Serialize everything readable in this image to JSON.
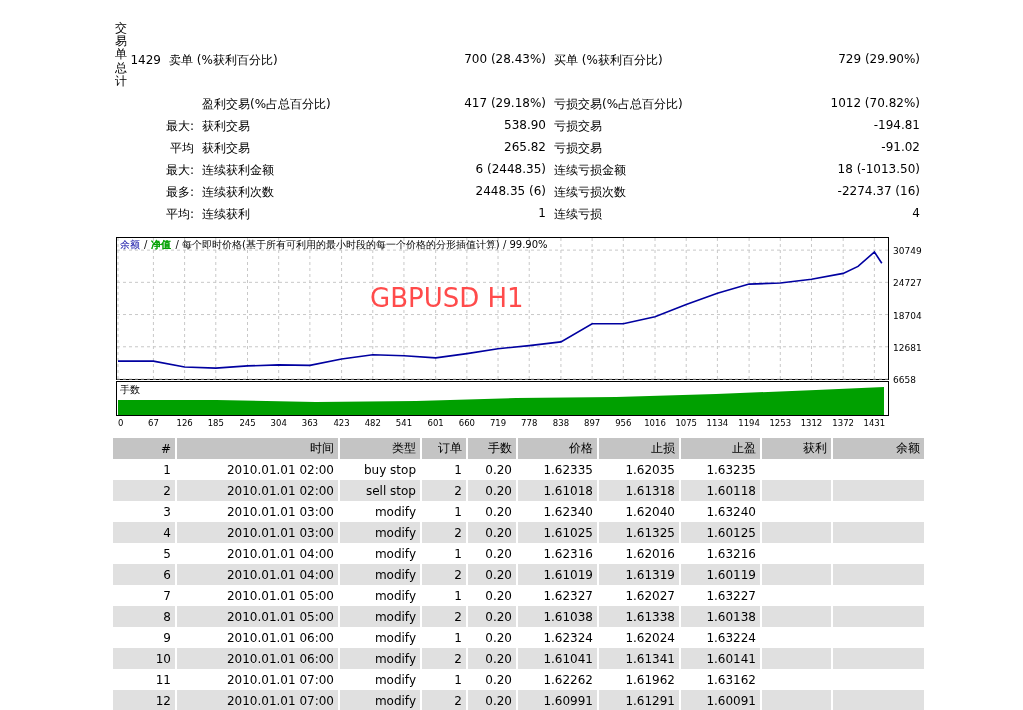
{
  "stats": {
    "side_label": "交易单总计",
    "rows": [
      {
        "count": "1429",
        "label": "卖单 (%获利百分比)",
        "value": "700 (28.43%)",
        "label2": "买单 (%获利百分比)",
        "value2": "729 (29.90%)"
      },
      {
        "label": "盈利交易(%占总百分比)",
        "value": "417 (29.18%)",
        "label2": "亏损交易(%占总百分比)",
        "value2": "1012 (70.82%)"
      },
      {
        "prefix": "最大:",
        "label": "获利交易",
        "value": "538.90",
        "label2": "亏损交易",
        "value2": "-194.81"
      },
      {
        "prefix": "平均",
        "label": "获利交易",
        "value": "265.82",
        "label2": "亏损交易",
        "value2": "-91.02"
      },
      {
        "prefix": "最大:",
        "label": "连续获利金额",
        "value": "6 (2448.35)",
        "label2": "连续亏损金额",
        "value2": "18 (-1013.50)"
      },
      {
        "prefix": "最多:",
        "label": "连续获利次数",
        "value": "2448.35 (6)",
        "label2": "连续亏损次数",
        "value2": "-2274.37 (16)"
      },
      {
        "prefix": "平均:",
        "label": "连续获利",
        "value": "1",
        "label2": "连续亏损",
        "value2": "4"
      }
    ]
  },
  "chart": {
    "legend": [
      {
        "text": "/"
      },
      {
        "text": "净值",
        "color": "#00a000"
      },
      {
        "text": "/ 每个即时价格(基于所有可利用的最小时段的每一个价格的分形插值计算) / 99.90%"
      }
    ],
    "overlay_label": "GBPUSD H1",
    "volume_label": "手数",
    "chart_data": {
      "type": "line",
      "x": [
        0,
        67,
        126,
        185,
        245,
        304,
        363,
        423,
        482,
        541,
        601,
        660,
        719,
        778,
        838,
        897,
        956,
        1016,
        1075,
        1134,
        1194,
        1253,
        1312,
        1372,
        1400,
        1431,
        1445
      ],
      "series": [
        {
          "name": "余额",
          "color": "#0000a0",
          "values": [
            10000,
            10000,
            8900,
            8700,
            9100,
            9300,
            9200,
            10400,
            11200,
            11000,
            10600,
            11400,
            12300,
            12900,
            13600,
            17000,
            17000,
            18300,
            20600,
            22700,
            24400,
            24600,
            25300,
            26400,
            27700,
            30400,
            28300
          ]
        }
      ],
      "grid": true,
      "xlim": [
        0,
        1453
      ],
      "ylim": [
        6658,
        33200
      ],
      "xticks": [
        0,
        67,
        126,
        185,
        245,
        304,
        363,
        423,
        482,
        541,
        601,
        660,
        719,
        778,
        838,
        897,
        956,
        1016,
        1075,
        1134,
        1194,
        1253,
        1312,
        1372,
        1431
      ],
      "yticks": [
        6658,
        12681,
        18704,
        24727,
        30749
      ]
    }
  },
  "table": {
    "columns": [
      "#",
      "时间",
      "类型",
      "订单",
      "手数",
      "价格",
      "止损",
      "止盈",
      "获利",
      "余额"
    ],
    "rows": [
      [
        "1",
        "2010.01.01 02:00",
        "buy stop",
        "1",
        "0.20",
        "1.62335",
        "1.62035",
        "1.63235"
      ],
      [
        "2",
        "2010.01.01 02:00",
        "sell stop",
        "2",
        "0.20",
        "1.61018",
        "1.61318",
        "1.60118"
      ],
      [
        "3",
        "2010.01.01 03:00",
        "modify",
        "1",
        "0.20",
        "1.62340",
        "1.62040",
        "1.63240"
      ],
      [
        "4",
        "2010.01.01 03:00",
        "modify",
        "2",
        "0.20",
        "1.61025",
        "1.61325",
        "1.60125"
      ],
      [
        "5",
        "2010.01.01 04:00",
        "modify",
        "1",
        "0.20",
        "1.62316",
        "1.62016",
        "1.63216"
      ],
      [
        "6",
        "2010.01.01 04:00",
        "modify",
        "2",
        "0.20",
        "1.61019",
        "1.61319",
        "1.60119"
      ],
      [
        "7",
        "2010.01.01 05:00",
        "modify",
        "1",
        "0.20",
        "1.62327",
        "1.62027",
        "1.63227"
      ],
      [
        "8",
        "2010.01.01 05:00",
        "modify",
        "2",
        "0.20",
        "1.61038",
        "1.61338",
        "1.60138"
      ],
      [
        "9",
        "2010.01.01 06:00",
        "modify",
        "1",
        "0.20",
        "1.62324",
        "1.62024",
        "1.63224"
      ],
      [
        "10",
        "2010.01.01 06:00",
        "modify",
        "2",
        "0.20",
        "1.61041",
        "1.61341",
        "1.60141"
      ],
      [
        "11",
        "2010.01.01 07:00",
        "modify",
        "1",
        "0.20",
        "1.62262",
        "1.61962",
        "1.63162"
      ],
      [
        "12",
        "2010.01.01 07:00",
        "modify",
        "2",
        "0.20",
        "1.60991",
        "1.61291",
        "1.60091"
      ]
    ]
  }
}
